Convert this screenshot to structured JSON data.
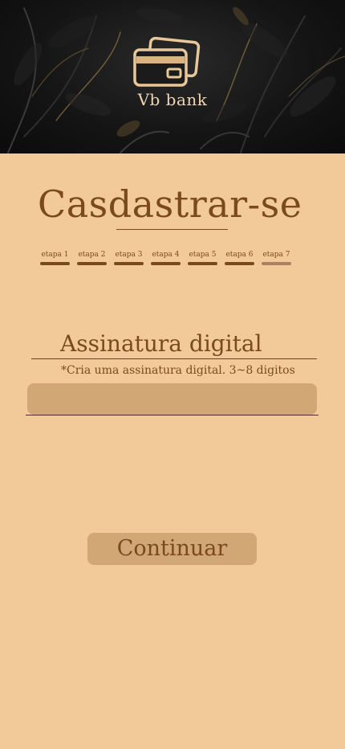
{
  "header": {
    "brand_name": "Vb bank",
    "logo_icon": "credit-card-icon",
    "background": "dark-floral-leaves"
  },
  "page": {
    "title": "Casdastrar-se"
  },
  "progress": {
    "steps": [
      {
        "label": "etapa 1",
        "status": "complete"
      },
      {
        "label": "etapa 2",
        "status": "complete"
      },
      {
        "label": "etapa 3",
        "status": "complete"
      },
      {
        "label": "etapa 4",
        "status": "complete"
      },
      {
        "label": "etapa 5",
        "status": "complete"
      },
      {
        "label": "etapa 6",
        "status": "complete"
      },
      {
        "label": "etapa 7",
        "status": "pending"
      }
    ]
  },
  "signature": {
    "heading": "Assinatura digital",
    "hint": "*Cria uma assinatura digital. 3~8 digitos",
    "value": "",
    "placeholder": ""
  },
  "actions": {
    "continue_label": "Continuar"
  },
  "colors": {
    "background": "#f2ca9a",
    "accent": "#7a4a1c",
    "field_fill": "#d1a776",
    "step_pending": "#a88360",
    "brand_text": "#f0d6b4"
  }
}
